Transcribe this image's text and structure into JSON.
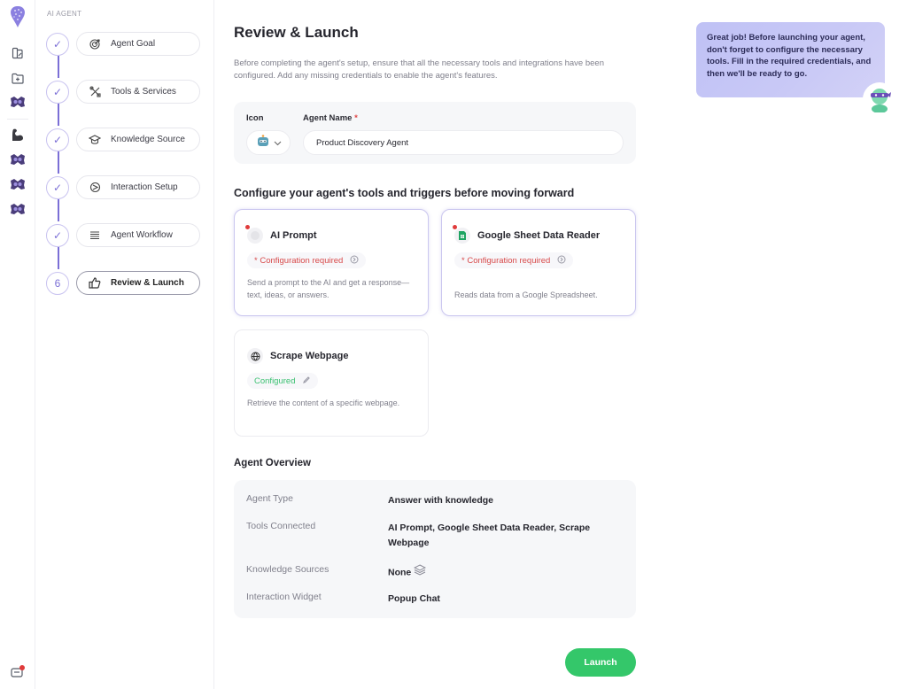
{
  "rail": {
    "icons": [
      "logo-icon",
      "dashboard-icon",
      "folder-add-icon",
      "agent-mascot-icon",
      "muscle-icon",
      "agent-mascot-icon",
      "agent-mascot-icon",
      "agent-mascot-icon"
    ],
    "bottom_icon": "notifications-icon"
  },
  "steps": {
    "eyebrow": "AI AGENT",
    "items": [
      {
        "label": "Agent Goal",
        "icon": "target-icon",
        "status": "done",
        "marker": "✓"
      },
      {
        "label": "Tools & Services",
        "icon": "tools-icon",
        "status": "done",
        "marker": "✓"
      },
      {
        "label": "Knowledge Source",
        "icon": "graduation-cap-icon",
        "status": "done",
        "marker": "✓"
      },
      {
        "label": "Interaction Setup",
        "icon": "interaction-icon",
        "status": "done",
        "marker": "✓"
      },
      {
        "label": "Agent Workflow",
        "icon": "workflow-icon",
        "status": "done",
        "marker": "✓"
      },
      {
        "label": "Review & Launch",
        "icon": "thumbs-up-icon",
        "status": "active",
        "marker": "6"
      }
    ]
  },
  "main": {
    "title": "Review & Launch",
    "description": "Before completing the agent's setup, ensure that all the necessary tools and integrations have been configured. Add any missing credentials to enable the agent's features.",
    "icon_label": "Icon",
    "icon_value": "robot-icon",
    "name_label": "Agent Name",
    "name_required": "*",
    "name_value": "Product Discovery Agent",
    "tools_title": "Configure your agent's tools and triggers before moving forward",
    "tools": [
      {
        "name": "AI Prompt",
        "icon": "ai-prompt-icon",
        "status": "* Configuration required",
        "state": "required",
        "description": "Send a prompt to the AI and get a response—text, ideas, or answers."
      },
      {
        "name": "Google Sheet Data Reader",
        "icon": "google-sheets-icon",
        "status": "* Configuration required",
        "state": "required",
        "description": "Reads data from a Google Spreadsheet."
      },
      {
        "name": "Scrape Webpage",
        "icon": "globe-icon",
        "status": "Configured",
        "state": "configured",
        "description": "Retrieve the content of a specific webpage."
      }
    ],
    "overview_title": "Agent Overview",
    "overview": [
      {
        "key": "Agent Type",
        "value": "Answer with knowledge"
      },
      {
        "key": "Tools Connected",
        "value": "AI Prompt, Google Sheet Data Reader, Scrape Webpage"
      },
      {
        "key": "Knowledge Sources",
        "value": "None"
      },
      {
        "key": "Interaction Widget",
        "value": "Popup Chat"
      }
    ],
    "launch_label": "Launch"
  },
  "assistant": {
    "message": "Great job! Before launching your agent, don't forget to configure the necessary tools. Fill in the required credentials, and then we'll be ready to go."
  },
  "colors": {
    "accent": "#7b6fd6",
    "success": "#34c76a",
    "error": "#d84a4a"
  }
}
